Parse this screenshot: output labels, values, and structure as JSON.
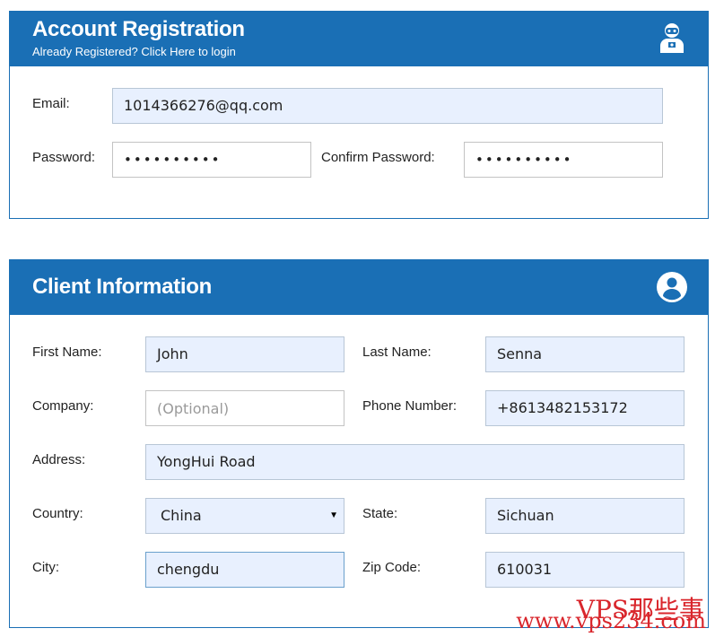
{
  "account": {
    "title": "Account Registration",
    "subtitle": "Already Registered? Click Here to login",
    "email_label": "Email:",
    "email_value": "1014366276@qq.com",
    "password_label": "Password:",
    "password_value": "••••••••••",
    "confirm_label": "Confirm Password:",
    "confirm_value": "••••••••••",
    "icon": "robot-icon"
  },
  "client": {
    "title": "Client Information",
    "icon": "user-circle-icon",
    "first_name_label": "First Name:",
    "first_name_value": "John",
    "last_name_label": "Last Name:",
    "last_name_value": "Senna",
    "company_label": "Company:",
    "company_placeholder": "(Optional)",
    "phone_label": "Phone Number:",
    "phone_value": "+8613482153172",
    "address_label": "Address:",
    "address_value": "YongHui Road",
    "country_label": "Country:",
    "country_value": "China",
    "state_label": "State:",
    "state_value": "Sichuan",
    "city_label": "City:",
    "city_value": "chengdu",
    "zip_label": "Zip Code:",
    "zip_value": "610031"
  },
  "watermark": {
    "line1": "VPS那些事",
    "line2": "www.vps234.com"
  },
  "colors": {
    "header": "#1a6fb5",
    "field_bg": "#e8f0fe",
    "watermark": "#d9262c"
  }
}
